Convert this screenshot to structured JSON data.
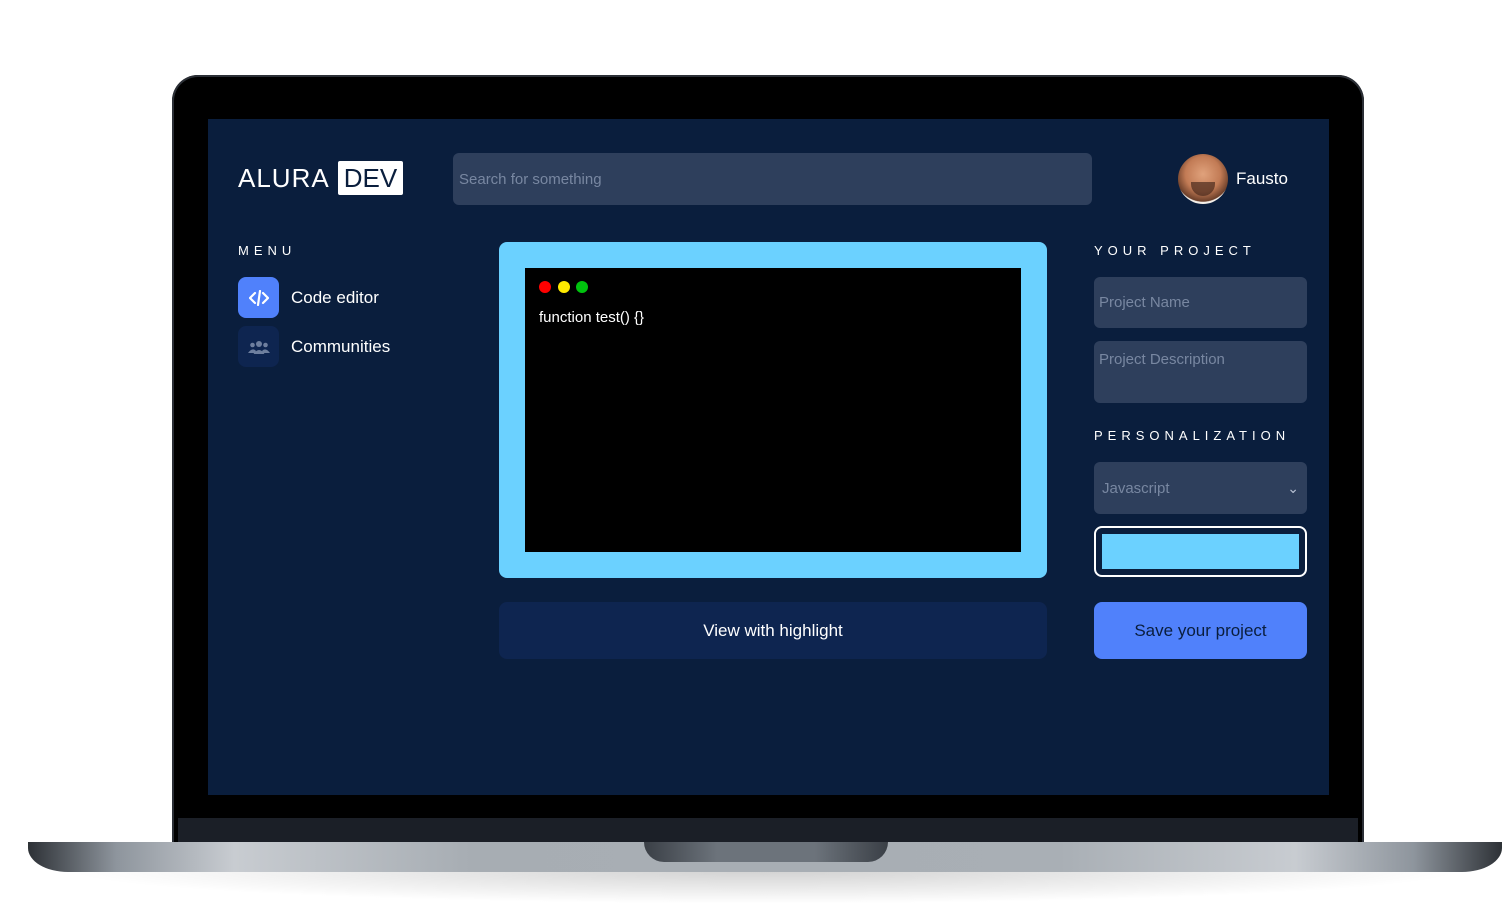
{
  "brand": {
    "part1": "ALURA",
    "part2": "DEV"
  },
  "search": {
    "placeholder": "Search for something"
  },
  "user": {
    "name": "Fausto"
  },
  "menu": {
    "title": "MENU",
    "items": [
      {
        "label": "Code editor",
        "icon": "code-icon",
        "active": true
      },
      {
        "label": "Communities",
        "icon": "users-icon",
        "active": false
      }
    ]
  },
  "editor": {
    "code": "function test() {}",
    "frame_color": "#6bd1ff",
    "dots": [
      "#ff0000",
      "#ffea00",
      "#00c30e"
    ],
    "highlight_button": "View with highlight"
  },
  "project": {
    "title": "YOUR PROJECT",
    "name_placeholder": "Project Name",
    "description_placeholder": "Project Description"
  },
  "personalization": {
    "title": "PERSONALIZATION",
    "language": "Javascript",
    "color": "#6bd1ff"
  },
  "save_button": "Save your project",
  "colors": {
    "background": "#0a1e3d",
    "accent": "#5081fb",
    "field": "#2e3f5c"
  }
}
